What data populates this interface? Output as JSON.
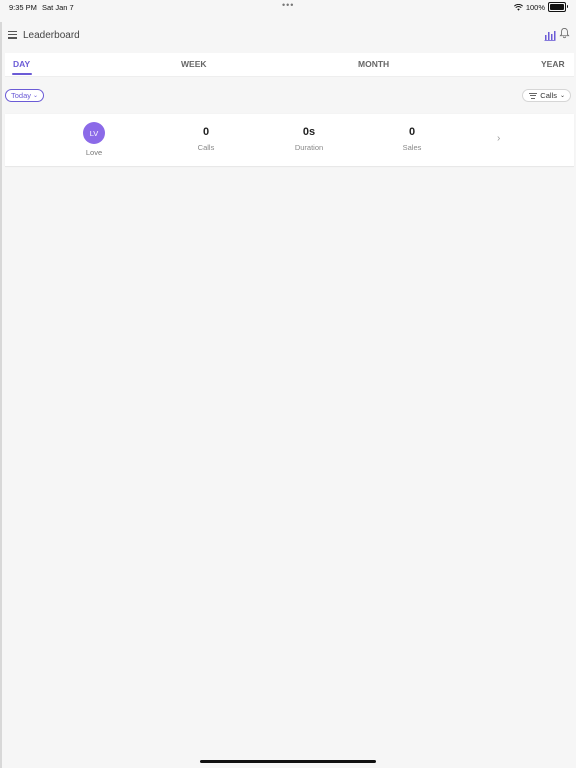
{
  "status_bar": {
    "time": "9:35 PM",
    "date": "Sat Jan 7",
    "dots": "•••",
    "battery_text": "100%",
    "battery_level": 1.0,
    "wifi_icon": "wifi-icon",
    "battery_icon": "battery-icon"
  },
  "header": {
    "title": "Leaderboard",
    "menu_icon": "menu-icon",
    "chart_icon": "bar-chart-icon",
    "bell_icon": "bell-icon"
  },
  "tabs": [
    {
      "label": "DAY",
      "active": true
    },
    {
      "label": "WEEK",
      "active": false
    },
    {
      "label": "MONTH",
      "active": false
    },
    {
      "label": "YEAR",
      "active": false
    }
  ],
  "filters": {
    "period": "Today",
    "metric": "Calls"
  },
  "leaderboard": [
    {
      "initials": "LV",
      "name": "Love",
      "calls": "0",
      "calls_label": "Calls",
      "duration": "0s",
      "duration_label": "Duration",
      "sales": "0",
      "sales_label": "Sales"
    }
  ],
  "colors": {
    "accent": "#6b5bd6",
    "avatar": "#8b6ae8",
    "background": "#f6f6f6"
  }
}
